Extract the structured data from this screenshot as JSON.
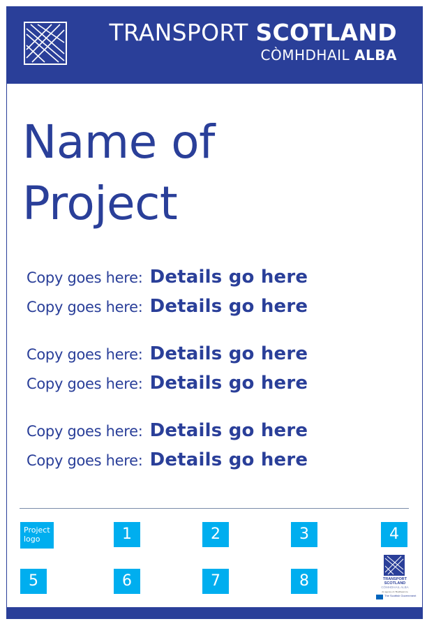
{
  "brand": {
    "line1_regular": "TRANSPORT",
    "line1_bold": "SCOTLAND",
    "line2_regular": "CÒMHDHAIL",
    "line2_bold": "ALBA",
    "logo_icon": "transport-scotland-logo-icon"
  },
  "title": {
    "line1": "Name of",
    "line2": "Project"
  },
  "rows": [
    {
      "copy": "Copy goes here:",
      "detail": "Details go here"
    },
    {
      "copy": "Copy goes here:",
      "detail": "Details go here"
    },
    {
      "copy": "Copy goes here:",
      "detail": "Details go here"
    },
    {
      "copy": "Copy goes here:",
      "detail": "Details go here"
    },
    {
      "copy": "Copy goes here:",
      "detail": "Details go here"
    },
    {
      "copy": "Copy goes here:",
      "detail": "Details go here"
    }
  ],
  "footer": {
    "project_logo_label": "Project logo",
    "slots": [
      "1",
      "2",
      "3",
      "4",
      "5",
      "6",
      "7",
      "8"
    ],
    "mini_logo": {
      "line1": "TRANSPORT",
      "line2": "SCOTLAND",
      "line3": "CÒMHDHAIL ALBA",
      "line4": "An agency of / Buidheann le",
      "gov": "The Scottish Government"
    }
  },
  "colors": {
    "brand_blue": "#2a3f99",
    "accent_cyan": "#00aeef",
    "rule": "#7a8ba8",
    "background": "#ffffff"
  }
}
